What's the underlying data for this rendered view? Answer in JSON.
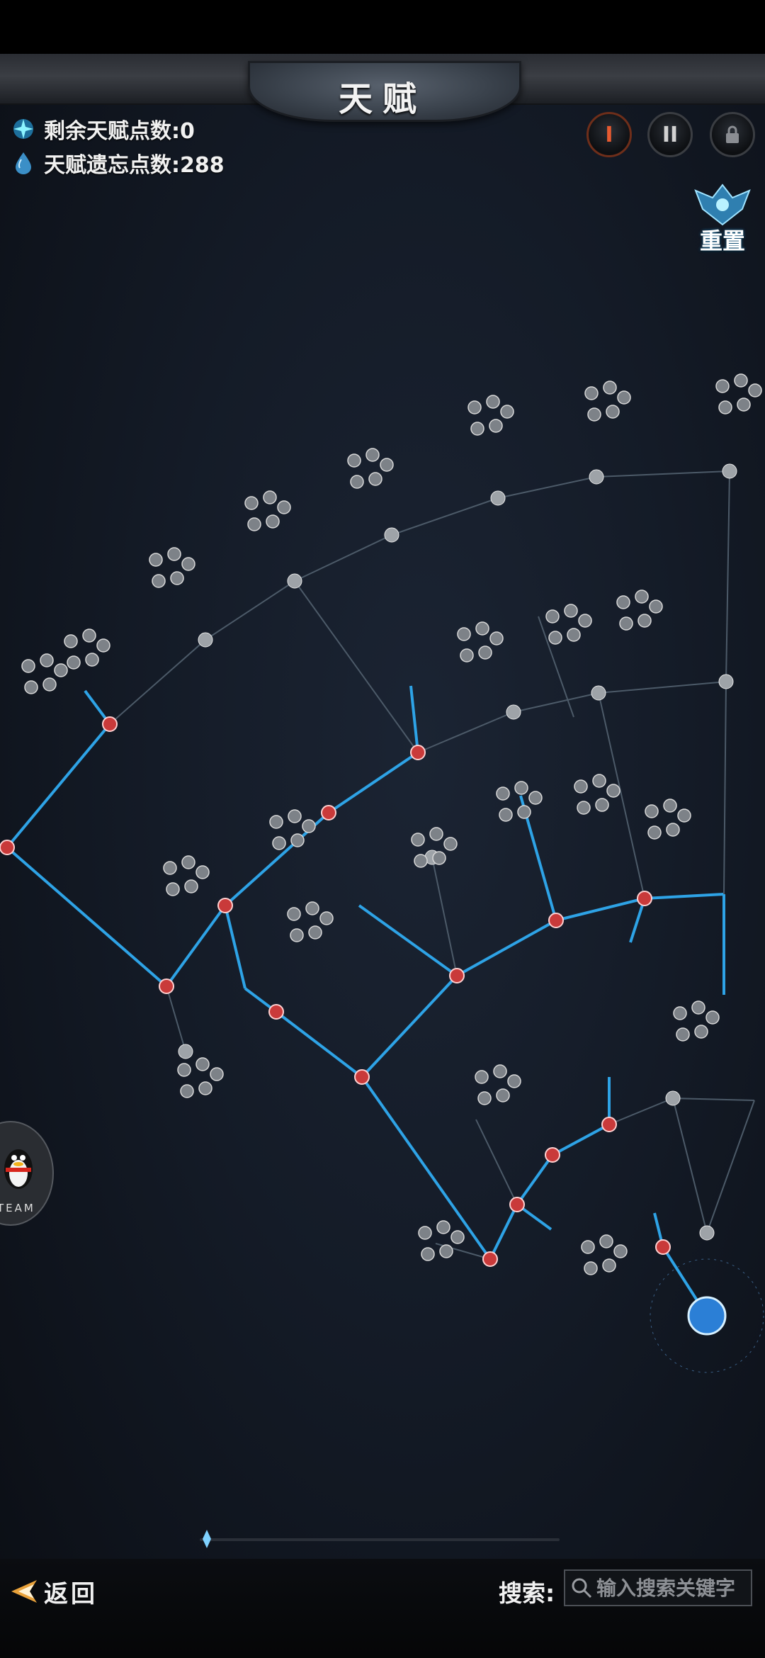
{
  "header": {
    "title": "天赋"
  },
  "stats": {
    "remaining_points": "剩余天赋点数:0",
    "forget_points": "天赋遗忘点数:288"
  },
  "top_buttons": [
    {
      "label": "I",
      "icon": "tier-one-icon",
      "accent": "#d9482b"
    },
    {
      "label": "II",
      "icon": "tier-two-icon",
      "accent": "#c9c9c9"
    },
    {
      "label": "",
      "icon": "lock-icon",
      "accent": "#9a9a9a"
    }
  ],
  "reset": {
    "label": "重置"
  },
  "floating": {
    "qq_label": "TEAM"
  },
  "footer": {
    "back_label": "返回",
    "search_label": "搜索:",
    "search_placeholder": "输入搜索关键字"
  },
  "colors": {
    "active_link": "#2ea3e6",
    "inactive_link": "#4c5a68",
    "active_node": "#c93a3a",
    "inactive_node": "#9ea3a8",
    "root_glow": "#2b7fd6"
  }
}
